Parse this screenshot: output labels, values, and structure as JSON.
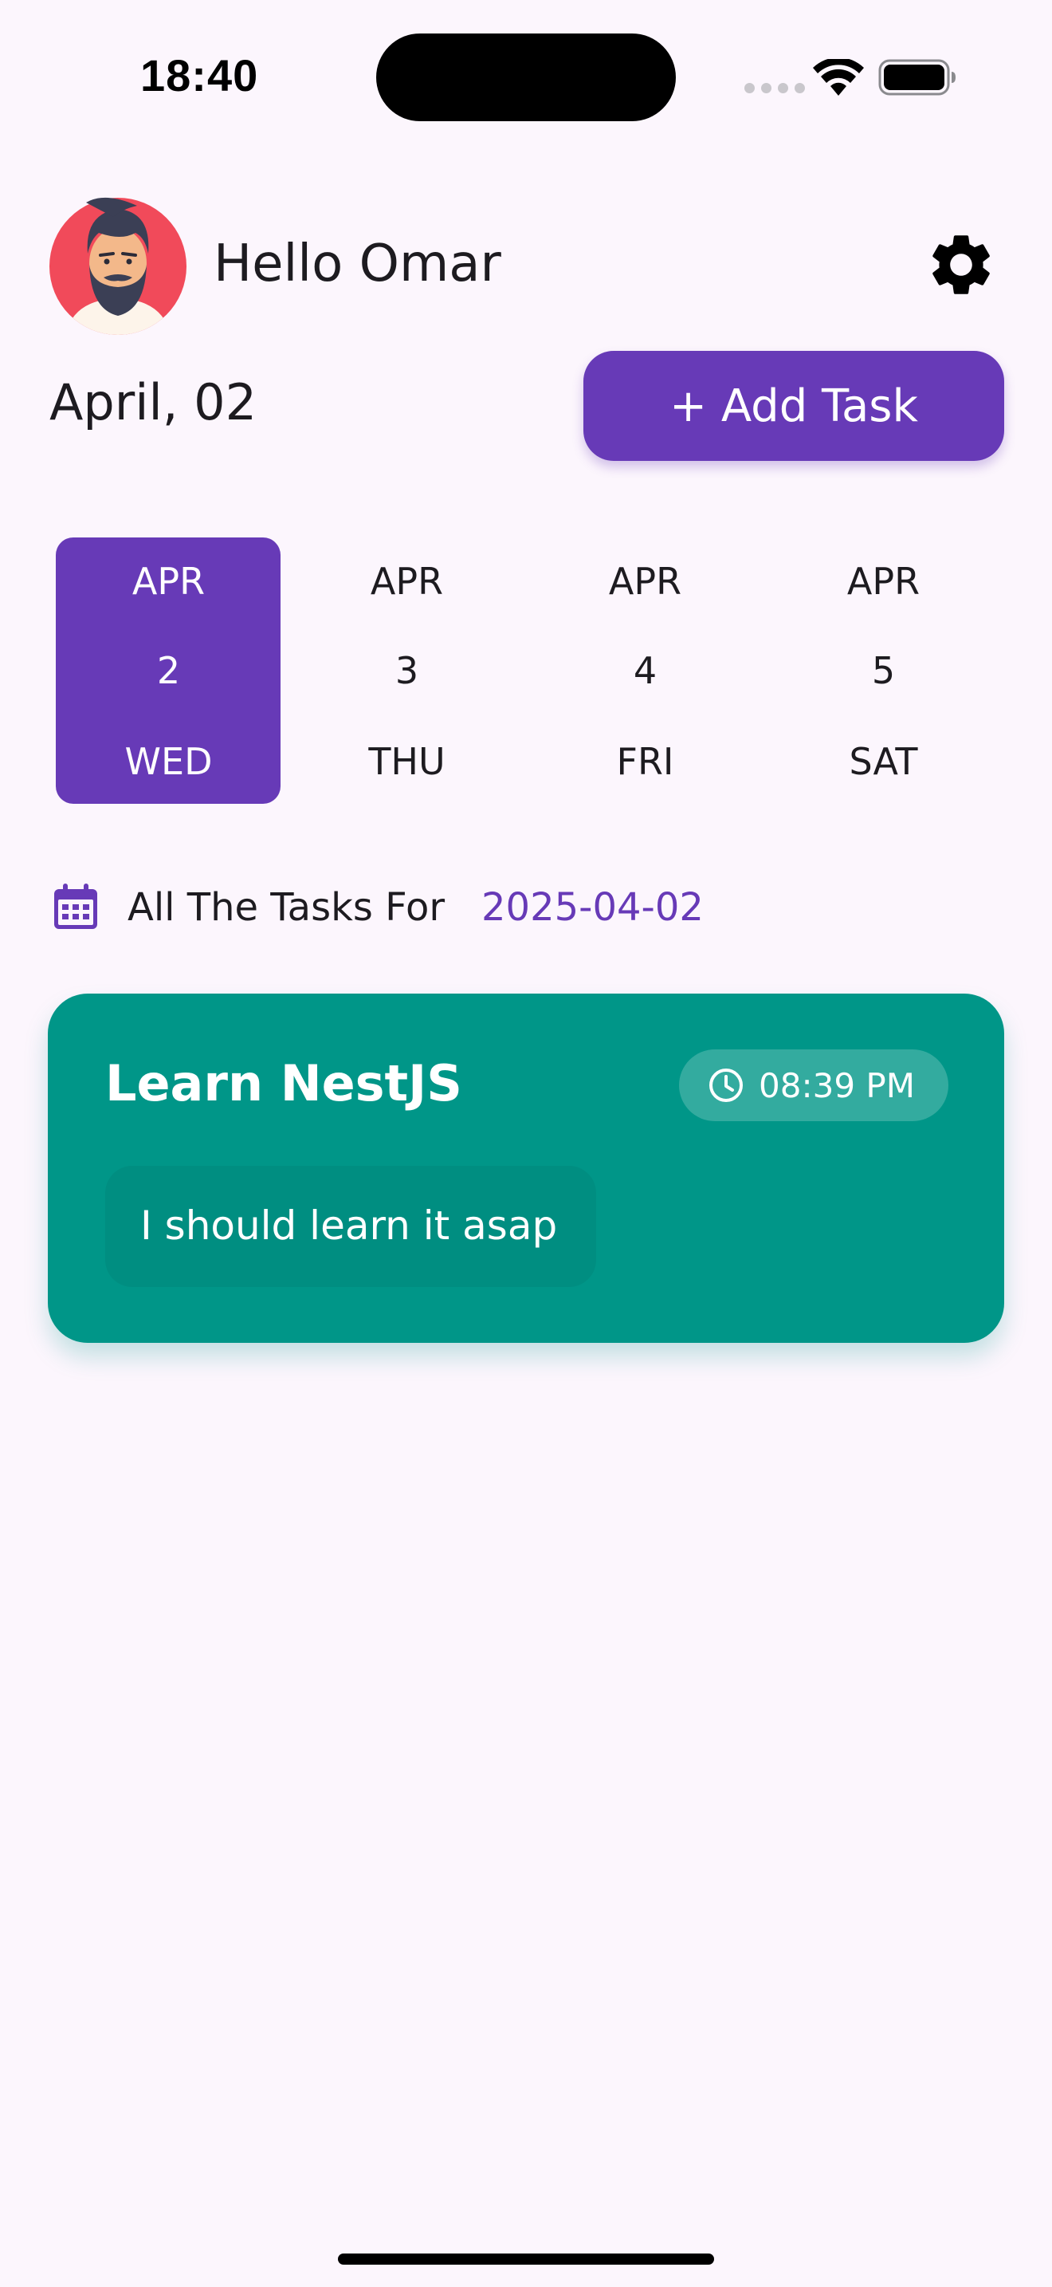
{
  "status_bar": {
    "time": "18:40",
    "icons": [
      "signal-dots-icon",
      "wifi-icon",
      "battery-icon"
    ]
  },
  "header": {
    "greeting": "Hello Omar",
    "avatar": "user-avatar",
    "settings_icon": "gear-icon"
  },
  "date_label": "April, 02",
  "add_task_label": "+ Add Task",
  "date_strip": [
    {
      "month": "APR",
      "day": "2",
      "weekday": "WED",
      "selected": true
    },
    {
      "month": "APR",
      "day": "3",
      "weekday": "THU",
      "selected": false
    },
    {
      "month": "APR",
      "day": "4",
      "weekday": "FRI",
      "selected": false
    },
    {
      "month": "APR",
      "day": "5",
      "weekday": "SAT",
      "selected": false
    }
  ],
  "tasks_section": {
    "heading": "All The Tasks For",
    "date": "2025-04-02",
    "icon": "calendar-icon"
  },
  "tasks": [
    {
      "title": "Learn NestJS",
      "time": "08:39 PM",
      "description": "I should learn it asap",
      "color": "#009688"
    }
  ],
  "colors": {
    "accent": "#673ab7",
    "background": "#fcf6fd",
    "task_card": "#009688"
  }
}
